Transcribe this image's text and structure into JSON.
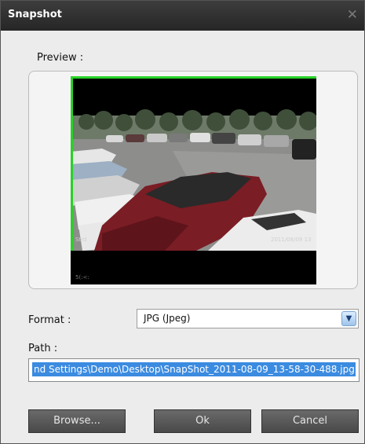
{
  "dialog": {
    "title": "Snapshot",
    "close_icon": "close-icon"
  },
  "preview": {
    "label": "Preview :"
  },
  "format": {
    "label": "Format :",
    "selected": "JPG (Jpeg)",
    "dropdown_icon": "chevron-down-icon"
  },
  "path": {
    "label": "Path :",
    "value": "nd Settings\\Demo\\Desktop\\SnapShot_2011-08-09_13-58-30-488.jpg"
  },
  "buttons": {
    "browse": "Browse...",
    "ok": "Ok",
    "cancel": "Cancel"
  },
  "colors": {
    "titlebar": "#2f2f2f",
    "dialog_bg": "#ececec",
    "selection": "#3b8be0",
    "button": "#5a5a5a",
    "green_border": "#28d228"
  }
}
